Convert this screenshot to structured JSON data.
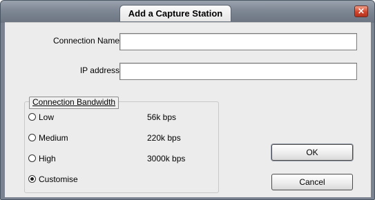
{
  "dialog": {
    "title": "Add a Capture Station",
    "close_glyph": "×"
  },
  "fields": {
    "connection_name": {
      "label": "Connection Name",
      "value": ""
    },
    "ip_address": {
      "label": "IP address",
      "value": ""
    }
  },
  "bandwidth": {
    "group_label": "Connection Bandwidth",
    "options": [
      {
        "label": "Low",
        "rate": "56k bps",
        "selected": false
      },
      {
        "label": "Medium",
        "rate": "220k bps",
        "selected": false
      },
      {
        "label": "High",
        "rate": "3000k bps",
        "selected": false
      },
      {
        "label": "Customise",
        "rate": "",
        "selected": true
      }
    ]
  },
  "buttons": {
    "ok_label": "OK",
    "cancel_label": "Cancel"
  },
  "colors": {
    "titlebar": "#7e8794",
    "close_button": "#d0452c",
    "dialog_background": "#ececec"
  },
  "icons": {
    "close": "close-icon",
    "radio": "radio-button"
  }
}
